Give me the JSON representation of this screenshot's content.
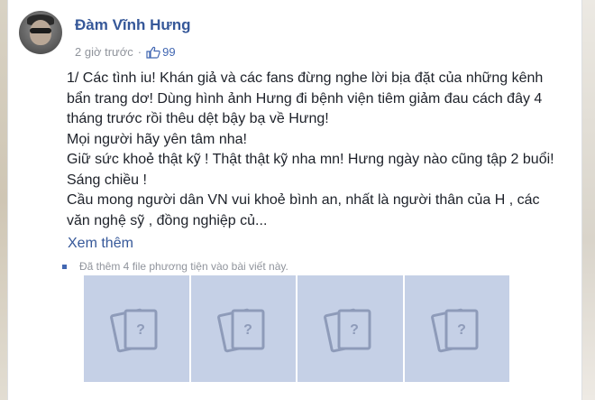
{
  "post": {
    "author_name": "Đàm Vĩnh Hưng",
    "time": "2 giờ trước",
    "separator": "·",
    "like_count": "99",
    "text_lines": [
      "1/ Các tình iu! Khán giả và các fans đừng nghe lời bịa đặt của những kênh",
      "bẩn trang dơ! Dùng hình ảnh Hưng đi bệnh viện tiêm giảm đau cách đây 4",
      "tháng trước rồi thêu dệt bậy bạ về Hưng!",
      "Mọi người hãy yên tâm nha!",
      "Giữ sức khoẻ thật kỹ ! Thật thật kỹ nha mn! Hưng ngày nào cũng tập 2 buổi!",
      "Sáng chiều !",
      "Cầu mong người dân VN vui khoẻ bình an, nhất là người thân của H , các",
      "văn nghệ sỹ , đồng nghiệp củ..."
    ],
    "see_more": "Xem thêm",
    "added_media_note": "Đã thêm 4 file phương tiện vào bài viết này.",
    "media_placeholder_glyph": "?",
    "media_count": 4
  },
  "colors": {
    "name_blue": "#365899",
    "tile_bg": "#c5d0e6",
    "placeholder_stroke": "#8e9bb9"
  },
  "icons": {
    "like": "thumbs-up-icon",
    "media": "missing-image-icon"
  }
}
